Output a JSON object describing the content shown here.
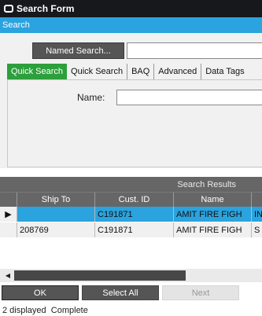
{
  "window": {
    "title": "Search Form"
  },
  "header": {
    "label": "Search"
  },
  "named_search": {
    "button_label": "Named Search...",
    "value": ""
  },
  "tabs": [
    {
      "label": "Quick Search",
      "active": true
    },
    {
      "label": "Quick Search",
      "active": false
    },
    {
      "label": "BAQ",
      "active": false
    },
    {
      "label": "Advanced",
      "active": false
    },
    {
      "label": "Data Tags",
      "active": false
    }
  ],
  "quick_search": {
    "name_label": "Name:",
    "name_value": ""
  },
  "results": {
    "title": "Search Results",
    "columns": [
      "Ship To",
      "Cust. ID",
      "Name",
      ""
    ],
    "rows": [
      {
        "indicator": "▶",
        "ship_to": "",
        "cust_id": "C191871",
        "name": "AMIT FIRE FIGH",
        "extra": "IN"
      },
      {
        "indicator": "",
        "ship_to": "208769",
        "cust_id": "C191871",
        "name": "AMIT FIRE FIGH",
        "extra": "S"
      }
    ]
  },
  "buttons": {
    "ok": "OK",
    "select_all": "Select All",
    "next": "Next"
  },
  "status": {
    "count": "2 displayed",
    "state": "Complete"
  },
  "colors": {
    "accent": "#2aa3df",
    "active_tab": "#2d9f3c",
    "dark": "#555555"
  }
}
